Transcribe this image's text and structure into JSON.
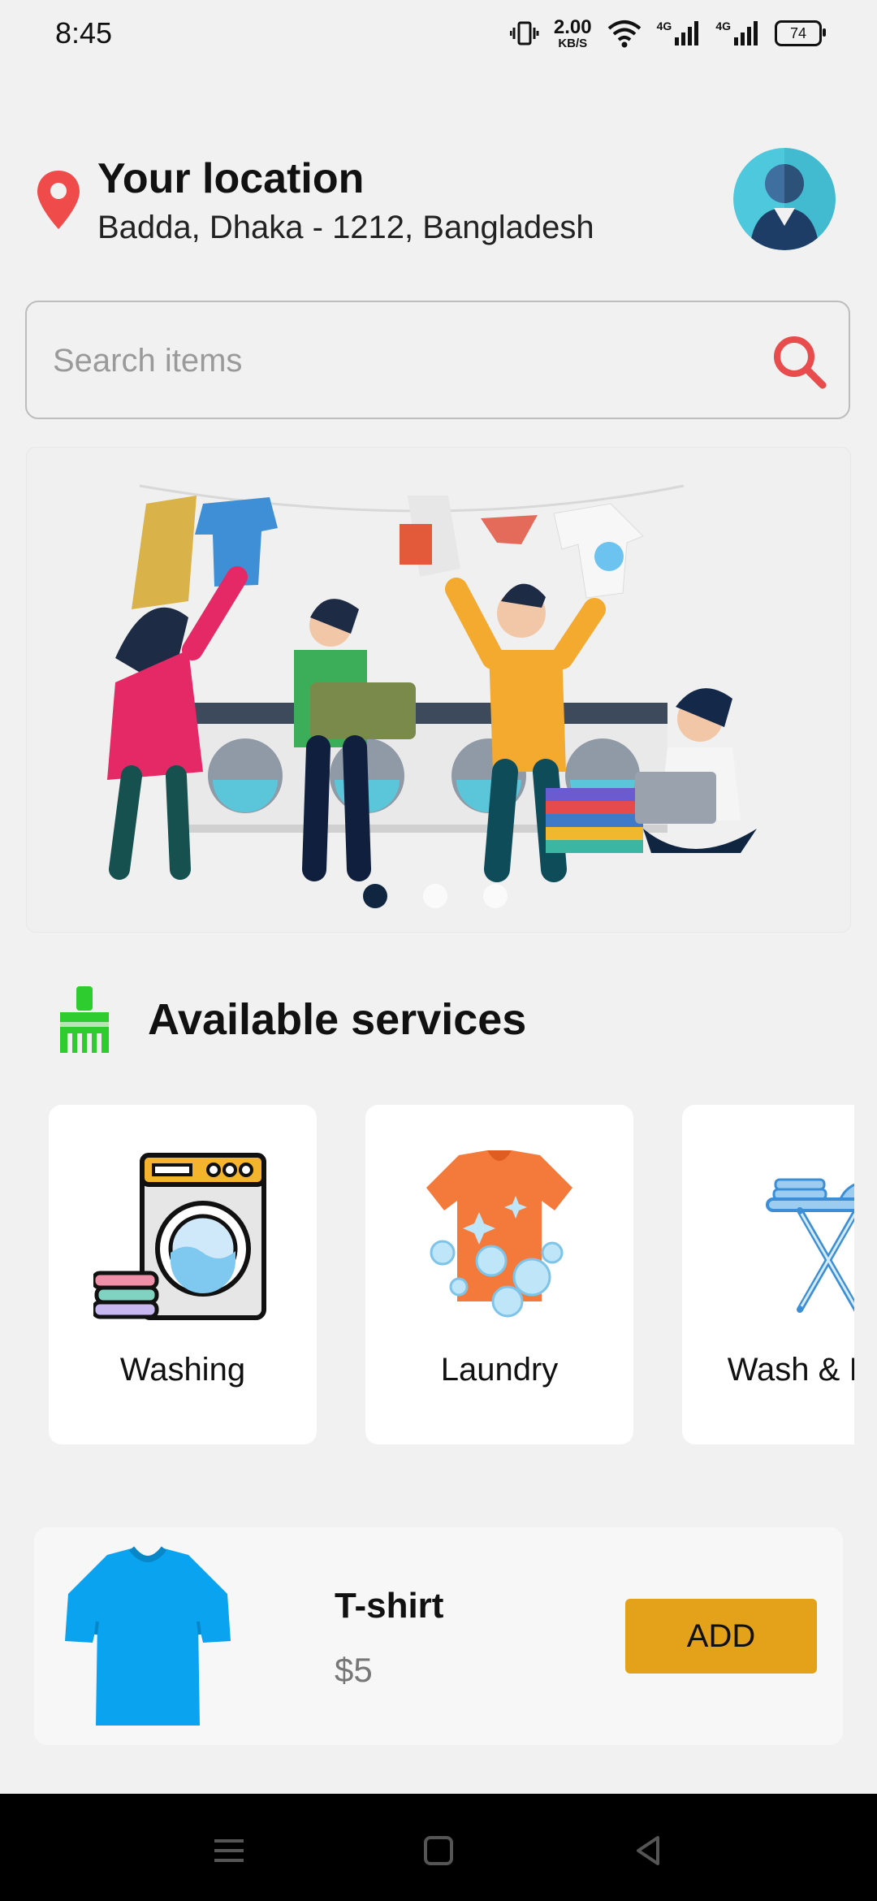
{
  "status_bar": {
    "time": "8:45",
    "net_speed_value": "2.00",
    "net_speed_unit": "KB/S",
    "network_1": "4G",
    "network_2": "4G",
    "battery": "74"
  },
  "header": {
    "title": "Your location",
    "address": "Badda, Dhaka - 1212, Bangladesh",
    "pin_color": "#f04b4b",
    "avatar_color": "#4ec8dc"
  },
  "search": {
    "placeholder": "Search items",
    "value": "",
    "icon": "search-icon",
    "icon_color": "#e84c4c"
  },
  "banner": {
    "slides_count": 3,
    "active_slide": 1
  },
  "services": {
    "title": "Available services",
    "icon": "broom-icon",
    "icon_color": "#2ecc2e",
    "items": [
      {
        "label": "Washing",
        "icon": "washing-machine-icon"
      },
      {
        "label": "Laundry",
        "icon": "tshirt-bubbles-icon"
      },
      {
        "label": "Wash & Iron",
        "icon": "ironing-board-icon"
      }
    ]
  },
  "product": {
    "name": "T-shirt",
    "price": "$5",
    "add_label": "ADD",
    "image_color": "#0aa3f0",
    "button_color": "#e3a21a"
  },
  "nav_bar": {
    "buttons": [
      "menu-icon",
      "home-icon",
      "back-icon"
    ]
  }
}
